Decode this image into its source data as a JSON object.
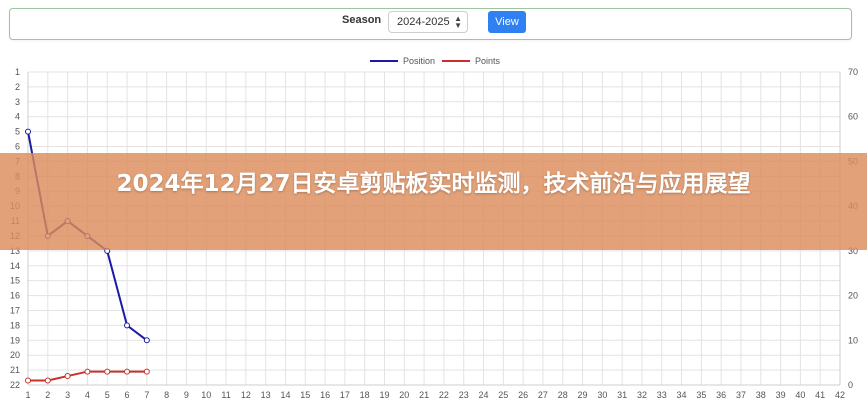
{
  "season_bar": {
    "label": "Season",
    "selected_season": "2024-2025",
    "view_button_label": "View",
    "select_icon": "chevron-up-down-icon"
  },
  "banner": {
    "title": "2024年12月27日安卓剪贴板实时监测，技术前沿与应用展望",
    "color": "#dc8c5a"
  },
  "chart_data": {
    "type": "line",
    "x": [
      1,
      2,
      3,
      4,
      5,
      6,
      7
    ],
    "x_ticks": [
      1,
      2,
      3,
      4,
      5,
      6,
      7,
      8,
      9,
      10,
      11,
      12,
      13,
      14,
      15,
      16,
      17,
      18,
      19,
      20,
      21,
      22,
      23,
      24,
      25,
      26,
      27,
      28,
      29,
      30,
      31,
      32,
      33,
      34,
      35,
      36,
      37,
      38,
      39,
      40,
      41,
      42
    ],
    "xlim": [
      1,
      42
    ],
    "y_left_ticks": [
      1,
      2,
      3,
      4,
      5,
      6,
      7,
      8,
      9,
      10,
      11,
      12,
      13,
      14,
      15,
      16,
      17,
      18,
      19,
      20,
      21,
      22
    ],
    "y_left_lim": [
      1,
      22
    ],
    "y_left_reversed": true,
    "y_right_ticks": [
      0,
      10,
      20,
      30,
      40,
      50,
      60,
      70
    ],
    "y_right_lim": [
      0,
      70
    ],
    "grid": true,
    "legend_position": "top-center",
    "series": [
      {
        "name": "Position",
        "axis": "left",
        "color": "#1a1aa8",
        "values": [
          5,
          12,
          11,
          12,
          13,
          18,
          19
        ]
      },
      {
        "name": "Points",
        "axis": "right",
        "color": "#c8302c",
        "values": [
          1,
          1,
          2,
          3,
          3,
          3,
          3
        ]
      }
    ]
  }
}
